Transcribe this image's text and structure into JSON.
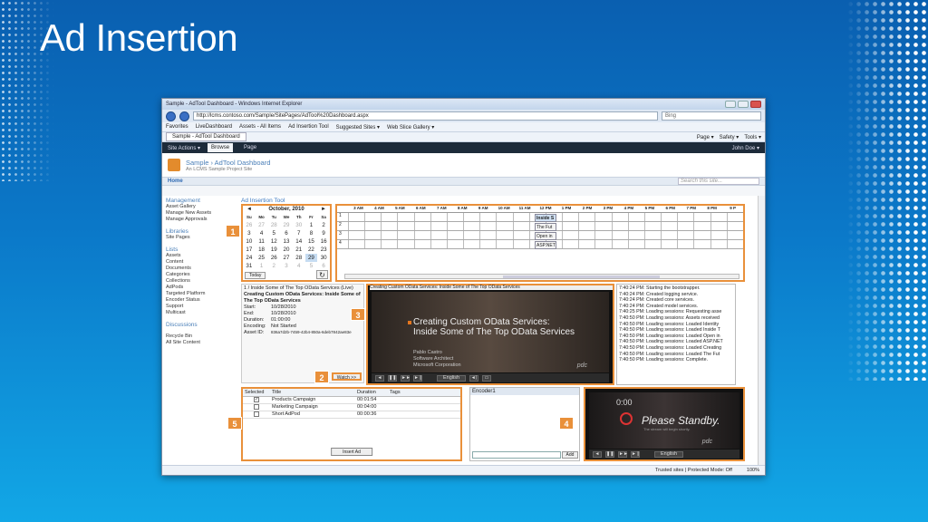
{
  "slide": {
    "title": "Ad Insertion"
  },
  "browser": {
    "window_title": "Sample - AdTool Dashboard - Windows Internet Explorer",
    "url": "http://lcms.contoso.com/Sample/SitePages/AdTool%20Dashboard.aspx",
    "search_placeholder": "Bing",
    "favorites": [
      "Favorites",
      "LiveDashboard",
      "Assets - All Items",
      "Ad Insertion Tool",
      "Suggested Sites ▾",
      "Web Slice Gallery ▾"
    ],
    "tab": "Sample - AdTool Dashboard",
    "tools": [
      "Page ▾",
      "Safety ▾",
      "Tools ▾"
    ]
  },
  "ribbon": {
    "site_actions": "Site Actions ▾",
    "tabs": [
      "Browse",
      "Page"
    ],
    "user": "John Doe ▾"
  },
  "site": {
    "title": "Sample › AdTool Dashboard",
    "subtitle": "An LCMS Sample Project Site",
    "home": "Home",
    "search_placeholder": "Search this site..."
  },
  "sidebar": [
    {
      "heading": "Management",
      "items": [
        "Asset Gallery",
        "Manage New Assets",
        "Manage Approvals"
      ]
    },
    {
      "heading": "Libraries",
      "items": [
        "Site Pages"
      ]
    },
    {
      "heading": "Lists",
      "items": [
        "Assets",
        "Content",
        "Documents",
        "Categories",
        "Collections",
        "AdPods",
        "Targeted Platform",
        "Encoder Status",
        "Support",
        "Multicast"
      ]
    },
    {
      "heading": "Discussions",
      "items": []
    },
    {
      "heading": "",
      "items": [
        "Recycle Bin",
        "All Site Content"
      ]
    }
  ],
  "tool_title": "Ad Insertion Tool",
  "calendar": {
    "month": "October, 2010",
    "weekdays": [
      "Su",
      "Mo",
      "Tu",
      "We",
      "Th",
      "Fr",
      "Sa"
    ],
    "days": [
      "26",
      "27",
      "28",
      "29",
      "30",
      "1",
      "2",
      "3",
      "4",
      "5",
      "6",
      "7",
      "8",
      "9",
      "10",
      "11",
      "12",
      "13",
      "14",
      "15",
      "16",
      "17",
      "18",
      "19",
      "20",
      "21",
      "22",
      "23",
      "24",
      "25",
      "26",
      "27",
      "28",
      "29",
      "30",
      "31",
      "1",
      "2",
      "3",
      "4",
      "5",
      "6"
    ],
    "today_label": "Today"
  },
  "timeline": {
    "hours": [
      "3 AM",
      "4 AM",
      "5 AM",
      "6 AM",
      "7 AM",
      "8 AM",
      "9 AM",
      "10 AM",
      "11 AM",
      "12 PM",
      "1 PM",
      "2 PM",
      "3 PM",
      "4 PM",
      "5 PM",
      "6 PM",
      "7 PM",
      "8 PM",
      "9 P"
    ],
    "rows": [
      "1",
      "2",
      "3",
      "4"
    ],
    "clips": [
      "Inside S",
      "The Fut",
      "Open in",
      "ASP.NET"
    ]
  },
  "event": {
    "heading": "1 / Inside Some of The Top OData Services (Live)",
    "title": "Creating Custom OData Services: Inside Some of The Top OData Services",
    "fields": [
      {
        "label": "Start:",
        "value": "10/28/2010"
      },
      {
        "label": "End:",
        "value": "10/28/2010"
      },
      {
        "label": "Duration:",
        "value": "01:00:00"
      },
      {
        "label": "Encoding:",
        "value": "Not Started"
      },
      {
        "label": "Asset ID:",
        "value": "836a7d2b-7459-42b4-850a-6deb7842ae83e"
      }
    ],
    "watch_label": "Watch >>"
  },
  "player": {
    "caption": "Creating Custom OData Services: Inside Some of The Top OData Services",
    "slide_title": "Creating Custom OData Services: Inside Some of The Top OData Services",
    "speaker": [
      "Pablo Castro",
      "Software Architect",
      "Microsoft Corporation"
    ],
    "brand": "pdc",
    "language": "English"
  },
  "log": [
    "7:40:24 PM: Starting the bootstrapper.",
    "7:40:24 PM: Created logging service.",
    "7:40:24 PM: Created core services.",
    "7:40:24 PM: Created model services.",
    "7:40:25 PM: Loading sessions: Requesting asse",
    "7:40:50 PM: Loading sessions: Assets received",
    "7:40:50 PM: Loading sessions: Loaded Identity",
    "7:40:50 PM: Loading sessions: Loaded Inside T",
    "7:40:50 PM: Loading sessions: Loaded Open in",
    "7:40:50 PM: Loading sessions: Loaded ASP.NET",
    "7:40:50 PM: Loading sessions: Loaded Creating",
    "7:40:50 PM: Loading sessions: Loaded The Fut",
    "7:40:50 PM: Loading sessions: Complete."
  ],
  "ads": {
    "columns": [
      "Selected",
      "Title",
      "Duration",
      "Tags"
    ],
    "rows": [
      {
        "checked": "✓",
        "title": "Products Campaign",
        "duration": "00:01:54",
        "tags": ""
      },
      {
        "checked": "",
        "title": "Marketing Campaign",
        "duration": "00:04:00",
        "tags": ""
      },
      {
        "checked": "",
        "title": "Short AdPod",
        "duration": "00:00:36",
        "tags": ""
      }
    ],
    "insert_label": "Insert Ad"
  },
  "encoder": {
    "header": "Encoder1",
    "add_label": "Add"
  },
  "player2": {
    "time": "0:00",
    "message": "Please Standby.",
    "sub": "The stream will begin shortly.",
    "brand": "pdc",
    "language": "English"
  },
  "badges": [
    "1",
    "2",
    "3",
    "4",
    "5"
  ],
  "statusbar": {
    "trusted": "Trusted sites | Protected Mode: Off",
    "zoom": "100%"
  }
}
